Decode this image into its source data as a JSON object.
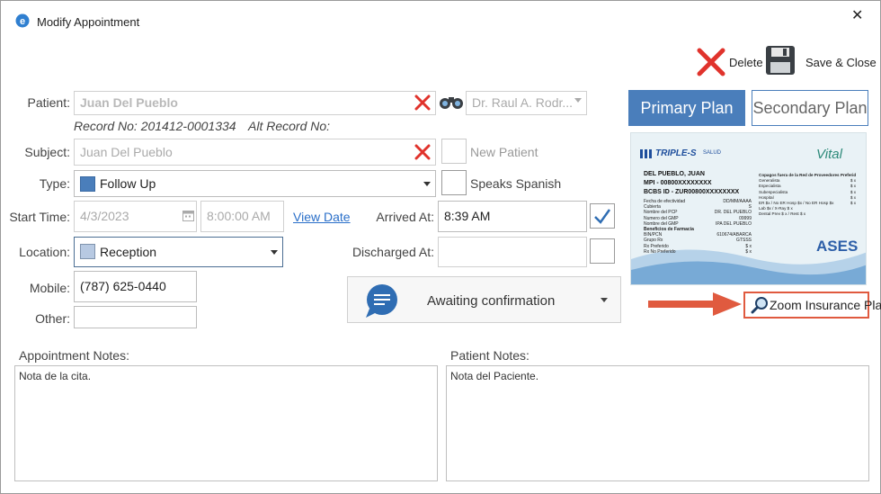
{
  "window": {
    "title": "Modify Appointment",
    "close_glyph": "✕",
    "app_icon": "e"
  },
  "toolbar": {
    "delete_label": "Delete",
    "save_close_label": "Save & Close"
  },
  "patient": {
    "label": "Patient:",
    "value": "Juan Del Pueblo",
    "record_no": "Record No: 201412-0001334",
    "alt_record_no": "Alt Record No:",
    "doctor_value": "Dr. Raul A. Rodr..."
  },
  "subject": {
    "label": "Subject:",
    "value": "Juan Del Pueblo"
  },
  "checkboxes": {
    "new_patient": "New Patient",
    "speaks_spanish": "Speaks Spanish"
  },
  "type": {
    "label": "Type:",
    "value": "Follow Up",
    "color": "#4a7ebb"
  },
  "start": {
    "label": "Start Time:",
    "date": "4/3/2023",
    "time": "8:00:00 AM",
    "view_date": "View Date"
  },
  "arrived": {
    "label": "Arrived At:",
    "value": "8:39 AM",
    "checked": true
  },
  "location": {
    "label": "Location:",
    "value": "Reception",
    "color": "#b7c9e2"
  },
  "discharged": {
    "label": "Discharged At:",
    "value": "",
    "checked": false
  },
  "mobile": {
    "label": "Mobile:",
    "value": "(787) 625-0440"
  },
  "other": {
    "label": "Other:",
    "value": ""
  },
  "status": {
    "value": "Awaiting confirmation",
    "icon_color": "#2f6db3"
  },
  "plans": {
    "primary": "Primary Plan",
    "secondary": "Secondary Plan",
    "primary_color": "#4a7ebb"
  },
  "insurance_card": {
    "brand": "TRIPLE-S",
    "brand_suffix": "SALUD",
    "vital_logo": "Vital",
    "ases_logo": "ASES",
    "name": "DEL PUEBLO, JUAN",
    "mpi": "MPI - 00800XXXXXXXX",
    "bcbs": "BCBS ID - ZUR00800XXXXXXXX",
    "left_rows": [
      [
        "Fecha de efectividad",
        "DD/MM/AAAA"
      ],
      [
        "Cubierta",
        "S"
      ],
      [
        "Nombre del PCP",
        "DR. DEL PUEBLO"
      ],
      [
        "Numero del GMP",
        "09999"
      ],
      [
        "Nombre del GMP",
        "IPA DEL PUEBLO"
      ]
    ],
    "pharmacy_header": "Beneficios de Farmacia",
    "pharmacy_rows": [
      [
        "BIN/PCN",
        "610674/ABARCA"
      ],
      [
        "Grupo Rx",
        "GTSSS"
      ],
      [
        "Rx Preferido",
        "$ x"
      ],
      [
        "Rx No Preferido",
        "$ x"
      ]
    ],
    "right_header": "Copagos fuera de la Red de Proveedores Preferidos",
    "right_rows": [
      [
        "Generalista",
        "$ x"
      ],
      [
        "Especialista",
        "$ x"
      ],
      [
        "Subespecialista",
        "$ x"
      ],
      [
        "Hospital",
        "$ x"
      ],
      [
        "ER $x / No ER Hosp $x / No ER Hosp $x",
        "$ x"
      ],
      [
        "Lab $x / X-Ray $ x",
        ""
      ],
      [
        "Dental Prev $ x / Rest $ x",
        ""
      ]
    ]
  },
  "zoom": {
    "label": "Zoom Insurance Plan",
    "arrow_color": "#e05a3f"
  },
  "notes": {
    "appointment_label": "Appointment Notes:",
    "appointment_value": "Nota de la cita.",
    "patient_label": "Patient Notes:",
    "patient_value": "Nota del Paciente."
  }
}
